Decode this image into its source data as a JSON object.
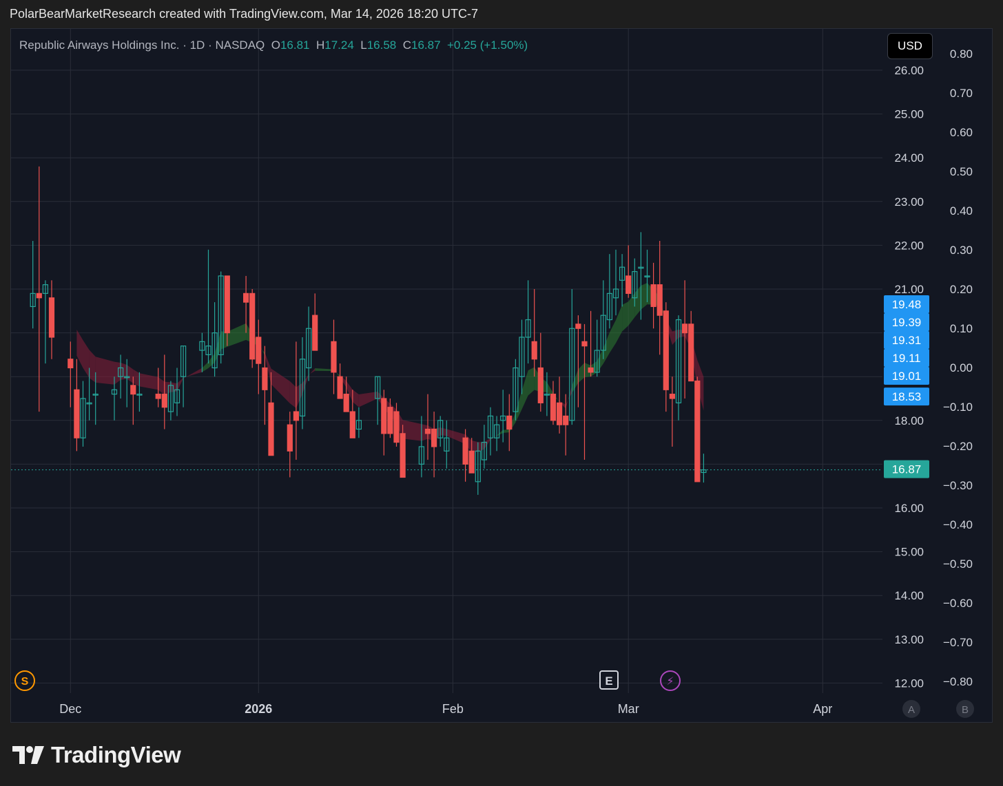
{
  "header": {
    "caption": "PolarBearMarketResearch created with TradingView.com, Mar 14, 2026 18:20 UTC-7"
  },
  "legend": {
    "name": "Republic Airways Holdings Inc.",
    "sep1": "·",
    "interval": "1D",
    "sep2": "·",
    "exchange": "NASDAQ",
    "o_label": "O",
    "o_value": "16.81",
    "h_label": "H",
    "h_value": "17.24",
    "l_label": "L",
    "l_value": "16.58",
    "c_label": "C",
    "c_value": "16.87",
    "change": "+0.25 (+1.50%)"
  },
  "currency_button": "USD",
  "markers": {
    "s_badge": "S",
    "e_badge": "E",
    "bolt_badge": "⚡"
  },
  "scale_buttons": [
    "A",
    "B"
  ],
  "brand": {
    "wordmark": "TradingView"
  },
  "colors": {
    "up": "#26a69a",
    "down": "#ef5350",
    "background": "#131722",
    "grid": "#2a2e39",
    "text": "#d1d4dc",
    "price_label": "#2196f3",
    "ribbon_green": "#2e7d32",
    "ribbon_red": "#8b1f3a",
    "ribbon_yellow": "#9c8a2e"
  },
  "chart_data": {
    "type": "candlestick",
    "ticker": "NASDAQ",
    "interval": "1D",
    "last_close": 16.87,
    "price_axis": {
      "ticks": [
        "26.00",
        "25.00",
        "24.00",
        "23.00",
        "22.00",
        "21.00",
        "20.00",
        "19.00",
        "18.00",
        "17.00",
        "16.00",
        "15.00",
        "14.00",
        "13.00",
        "12.00"
      ],
      "ylim": [
        12,
        26
      ]
    },
    "secondary_axis": {
      "ticks": [
        "0.80",
        "0.70",
        "0.60",
        "0.50",
        "0.40",
        "0.30",
        "0.20",
        "0.10",
        "0.00",
        "−0.10",
        "−0.20",
        "−0.30",
        "−0.40",
        "−0.50",
        "−0.60",
        "−0.70",
        "−0.80"
      ]
    },
    "x_axis": {
      "labels": [
        {
          "text": "Dec",
          "day": 3,
          "bold": false
        },
        {
          "text": "2026",
          "day": 33,
          "bold": true
        },
        {
          "text": "Feb",
          "day": 64,
          "bold": false
        },
        {
          "text": "Mar",
          "day": 92,
          "bold": false
        },
        {
          "text": "Apr",
          "day": 123,
          "bold": false
        }
      ]
    },
    "price_labels": [
      {
        "text": "19.48",
        "value": 19.48,
        "color": "#2196f3"
      },
      {
        "text": "19.39",
        "value": 19.39,
        "color": "#2196f3"
      },
      {
        "text": "19.31",
        "value": 19.31,
        "color": "#2196f3"
      },
      {
        "text": "19.11",
        "value": 19.11,
        "color": "#2196f3"
      },
      {
        "text": "19.01",
        "value": 19.01,
        "color": "#2196f3"
      },
      {
        "text": "18.53",
        "value": 18.53,
        "color": "#2196f3"
      },
      {
        "text": "16.87",
        "value": 16.87,
        "color": "#26a69a"
      }
    ],
    "candles": [
      {
        "d": -3,
        "o": 20.6,
        "h": 22.1,
        "l": 20.1,
        "c": 20.9
      },
      {
        "d": -2,
        "o": 20.9,
        "h": 23.8,
        "l": 18.2,
        "c": 20.8
      },
      {
        "d": -1,
        "o": 20.9,
        "h": 21.2,
        "l": 19.3,
        "c": 21.1
      },
      {
        "d": 0,
        "o": 20.8,
        "h": 21.2,
        "l": 19.4,
        "c": 19.9
      },
      {
        "d": 3,
        "o": 19.4,
        "h": 19.8,
        "l": 18.3,
        "c": 19.2
      },
      {
        "d": 4,
        "o": 18.7,
        "h": 19.4,
        "l": 17.3,
        "c": 17.6
      },
      {
        "d": 5,
        "o": 17.6,
        "h": 18.9,
        "l": 17.4,
        "c": 18.5
      },
      {
        "d": 6,
        "o": 18.4,
        "h": 19.2,
        "l": 18.0,
        "c": 18.4
      },
      {
        "d": 7,
        "o": 18.6,
        "h": 19.1,
        "l": 17.9,
        "c": 18.6
      },
      {
        "d": 10,
        "o": 18.6,
        "h": 19.0,
        "l": 18.0,
        "c": 18.7
      },
      {
        "d": 11,
        "o": 19.0,
        "h": 19.5,
        "l": 18.5,
        "c": 19.2
      },
      {
        "d": 12,
        "o": 19.0,
        "h": 19.4,
        "l": 18.3,
        "c": 19.0
      },
      {
        "d": 13,
        "o": 18.8,
        "h": 19.0,
        "l": 17.9,
        "c": 18.6
      },
      {
        "d": 14,
        "o": 18.6,
        "h": 19.1,
        "l": 18.2,
        "c": 18.6
      },
      {
        "d": 17,
        "o": 18.6,
        "h": 19.2,
        "l": 18.3,
        "c": 18.5
      },
      {
        "d": 18,
        "o": 18.6,
        "h": 19.5,
        "l": 17.8,
        "c": 18.3
      },
      {
        "d": 19,
        "o": 18.2,
        "h": 18.9,
        "l": 18.0,
        "c": 18.8
      },
      {
        "d": 20,
        "o": 18.4,
        "h": 19.2,
        "l": 18.1,
        "c": 18.7
      },
      {
        "d": 21,
        "o": 19.0,
        "h": 19.7,
        "l": 18.3,
        "c": 19.7
      },
      {
        "d": 24,
        "o": 19.6,
        "h": 20.0,
        "l": 19.1,
        "c": 19.8
      },
      {
        "d": 25,
        "o": 19.5,
        "h": 21.9,
        "l": 19.3,
        "c": 19.7
      },
      {
        "d": 26,
        "o": 19.2,
        "h": 20.7,
        "l": 19.0,
        "c": 20.0
      },
      {
        "d": 27,
        "o": 19.5,
        "h": 21.4,
        "l": 19.3,
        "c": 21.3
      },
      {
        "d": 28,
        "o": 21.3,
        "h": 21.1,
        "l": 19.7,
        "c": 20.0
      },
      {
        "d": 31,
        "o": 20.9,
        "h": 21.3,
        "l": 20.0,
        "c": 20.7
      },
      {
        "d": 32,
        "o": 20.9,
        "h": 21.0,
        "l": 19.2,
        "c": 19.4
      },
      {
        "d": 33,
        "o": 19.9,
        "h": 20.3,
        "l": 18.6,
        "c": 19.3
      },
      {
        "d": 34,
        "o": 19.2,
        "h": 19.7,
        "l": 17.9,
        "c": 18.7
      },
      {
        "d": 35,
        "o": 18.4,
        "h": 19.1,
        "l": 17.5,
        "c": 17.2
      },
      {
        "d": 38,
        "o": 17.9,
        "h": 18.2,
        "l": 16.7,
        "c": 17.3
      },
      {
        "d": 39,
        "o": 18.2,
        "h": 19.8,
        "l": 17.1,
        "c": 18.0
      },
      {
        "d": 40,
        "o": 18.1,
        "h": 19.9,
        "l": 17.8,
        "c": 19.4
      },
      {
        "d": 41,
        "o": 19.2,
        "h": 20.6,
        "l": 18.9,
        "c": 20.1
      },
      {
        "d": 42,
        "o": 20.4,
        "h": 20.9,
        "l": 19.6,
        "c": 19.6
      },
      {
        "d": 45,
        "o": 19.8,
        "h": 20.3,
        "l": 18.6,
        "c": 19.1
      },
      {
        "d": 46,
        "o": 19.0,
        "h": 19.3,
        "l": 18.5,
        "c": 18.5
      },
      {
        "d": 47,
        "o": 18.6,
        "h": 19.0,
        "l": 18.3,
        "c": 18.2
      },
      {
        "d": 48,
        "o": 18.2,
        "h": 18.7,
        "l": 17.7,
        "c": 17.6
      },
      {
        "d": 49,
        "o": 17.8,
        "h": 18.3,
        "l": 17.6,
        "c": 18.0
      },
      {
        "d": 52,
        "o": 18.5,
        "h": 19.0,
        "l": 17.9,
        "c": 19.0
      },
      {
        "d": 53,
        "o": 18.5,
        "h": 18.7,
        "l": 17.2,
        "c": 17.7
      },
      {
        "d": 54,
        "o": 18.3,
        "h": 18.5,
        "l": 17.6,
        "c": 17.7
      },
      {
        "d": 55,
        "o": 18.2,
        "h": 18.4,
        "l": 17.4,
        "c": 17.5
      },
      {
        "d": 56,
        "o": 17.7,
        "h": 17.9,
        "l": 16.8,
        "c": 16.7
      },
      {
        "d": 59,
        "o": 17.0,
        "h": 18.1,
        "l": 16.7,
        "c": 17.4
      },
      {
        "d": 60,
        "o": 17.8,
        "h": 18.6,
        "l": 17.1,
        "c": 17.7
      },
      {
        "d": 61,
        "o": 17.8,
        "h": 18.2,
        "l": 16.7,
        "c": 17.4
      },
      {
        "d": 62,
        "o": 17.6,
        "h": 18.1,
        "l": 17.4,
        "c": 18.0
      },
      {
        "d": 63,
        "o": 17.3,
        "h": 18.0,
        "l": 16.9,
        "c": 17.6
      },
      {
        "d": 66,
        "o": 17.6,
        "h": 17.8,
        "l": 16.6,
        "c": 17.0
      },
      {
        "d": 67,
        "o": 17.3,
        "h": 17.6,
        "l": 16.9,
        "c": 16.8
      },
      {
        "d": 68,
        "o": 16.6,
        "h": 17.5,
        "l": 16.3,
        "c": 17.3
      },
      {
        "d": 69,
        "o": 17.1,
        "h": 17.9,
        "l": 16.9,
        "c": 17.5
      },
      {
        "d": 70,
        "o": 17.6,
        "h": 18.3,
        "l": 17.2,
        "c": 18.1
      },
      {
        "d": 71,
        "o": 17.6,
        "h": 18.1,
        "l": 17.3,
        "c": 17.9
      },
      {
        "d": 72,
        "o": 18.0,
        "h": 18.7,
        "l": 17.5,
        "c": 18.1
      },
      {
        "d": 73,
        "o": 18.1,
        "h": 18.6,
        "l": 17.3,
        "c": 17.8
      },
      {
        "d": 74,
        "o": 18.2,
        "h": 19.4,
        "l": 18.0,
        "c": 19.2
      },
      {
        "d": 75,
        "o": 19.0,
        "h": 20.3,
        "l": 18.6,
        "c": 19.9
      },
      {
        "d": 76,
        "o": 19.9,
        "h": 21.2,
        "l": 19.3,
        "c": 20.3
      },
      {
        "d": 77,
        "o": 19.8,
        "h": 21.0,
        "l": 19.0,
        "c": 19.4
      },
      {
        "d": 78,
        "o": 19.2,
        "h": 20.0,
        "l": 18.2,
        "c": 18.4
      },
      {
        "d": 79,
        "o": 18.6,
        "h": 19.1,
        "l": 18.1,
        "c": 18.6
      },
      {
        "d": 80,
        "o": 18.6,
        "h": 18.9,
        "l": 17.9,
        "c": 18.0
      },
      {
        "d": 81,
        "o": 18.4,
        "h": 19.0,
        "l": 17.7,
        "c": 17.9
      },
      {
        "d": 82,
        "o": 18.1,
        "h": 18.6,
        "l": 17.2,
        "c": 17.9
      },
      {
        "d": 83,
        "o": 18.0,
        "h": 21.0,
        "l": 17.9,
        "c": 20.1
      },
      {
        "d": 84,
        "o": 20.2,
        "h": 20.4,
        "l": 18.3,
        "c": 20.1
      },
      {
        "d": 85,
        "o": 19.8,
        "h": 20.2,
        "l": 17.1,
        "c": 19.7
      },
      {
        "d": 86,
        "o": 19.2,
        "h": 20.5,
        "l": 19.0,
        "c": 19.1
      },
      {
        "d": 87,
        "o": 19.1,
        "h": 20.3,
        "l": 19.0,
        "c": 19.6
      },
      {
        "d": 88,
        "o": 19.6,
        "h": 21.2,
        "l": 19.4,
        "c": 20.4
      },
      {
        "d": 89,
        "o": 20.3,
        "h": 21.8,
        "l": 20.1,
        "c": 20.9
      },
      {
        "d": 90,
        "o": 20.8,
        "h": 21.9,
        "l": 20.4,
        "c": 21.0
      },
      {
        "d": 91,
        "o": 21.2,
        "h": 21.8,
        "l": 20.6,
        "c": 21.5
      },
      {
        "d": 92,
        "o": 21.3,
        "h": 22.0,
        "l": 20.8,
        "c": 20.9
      },
      {
        "d": 93,
        "o": 20.8,
        "h": 21.7,
        "l": 20.6,
        "c": 21.4
      },
      {
        "d": 94,
        "o": 21.5,
        "h": 22.3,
        "l": 20.3,
        "c": 21.5
      },
      {
        "d": 95,
        "o": 21.3,
        "h": 21.9,
        "l": 20.7,
        "c": 21.3
      },
      {
        "d": 96,
        "o": 21.1,
        "h": 21.6,
        "l": 20.1,
        "c": 20.6
      },
      {
        "d": 97,
        "o": 21.1,
        "h": 22.1,
        "l": 19.5,
        "c": 20.4
      },
      {
        "d": 98,
        "o": 20.5,
        "h": 20.7,
        "l": 18.2,
        "c": 18.7
      },
      {
        "d": 99,
        "o": 18.6,
        "h": 19.0,
        "l": 17.4,
        "c": 18.5
      },
      {
        "d": 100,
        "o": 18.4,
        "h": 20.4,
        "l": 18.0,
        "c": 20.3
      },
      {
        "d": 101,
        "o": 20.2,
        "h": 21.2,
        "l": 18.5,
        "c": 20.0
      },
      {
        "d": 102,
        "o": 20.2,
        "h": 20.5,
        "l": 19.0,
        "c": 18.9
      },
      {
        "d": 103,
        "o": 18.9,
        "h": 19.0,
        "l": 16.7,
        "c": 16.6
      },
      {
        "d": 104,
        "o": 16.81,
        "h": 17.24,
        "l": 16.58,
        "c": 16.87
      }
    ]
  }
}
